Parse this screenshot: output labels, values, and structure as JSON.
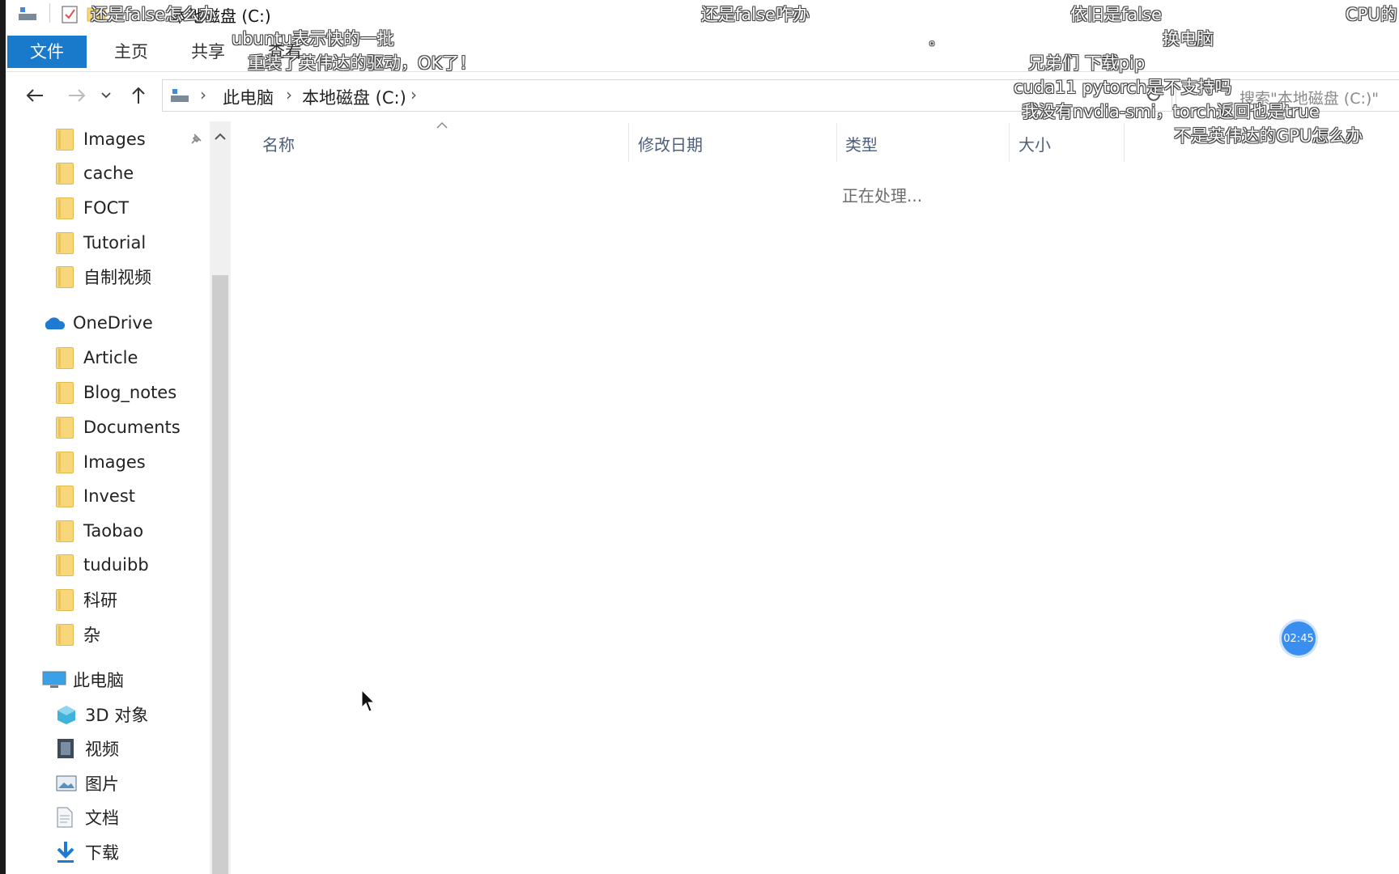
{
  "window": {
    "title": "本地磁盘 (C:)"
  },
  "ribbon": {
    "tabs": [
      "文件",
      "主页",
      "共享",
      "查看"
    ]
  },
  "address": {
    "crumbs": [
      "此电脑",
      "本地磁盘 (C:)"
    ],
    "search_placeholder": "搜索\"本地磁盘 (C:)\""
  },
  "sidebar": {
    "quick_access": [
      "Images",
      "cache",
      "FOCT",
      "Tutorial",
      "自制视频"
    ],
    "onedrive_label": "OneDrive",
    "onedrive_items": [
      "Article",
      "Blog_notes",
      "Documents",
      "Images",
      "Invest",
      "Taobao",
      "tuduibb",
      "科研",
      "杂"
    ],
    "this_pc_label": "此电脑",
    "this_pc_items": [
      "3D 对象",
      "视频",
      "图片",
      "文档",
      "下载"
    ]
  },
  "content": {
    "columns": [
      "名称",
      "修改日期",
      "类型",
      "大小"
    ],
    "status": "正在处理..."
  },
  "overlay": {
    "danmu": [
      "还是false怎么办",
      "还是false咋办",
      "依旧是false",
      "CPU的",
      "ubuntu表示快的一批",
      "换电脑",
      "重装了英伟达的驱动，OK了！",
      "兄弟们 下载pip",
      "cuda11 pytorch是不支持吗",
      "我没有nvdia-smi，torch返回也是true",
      "不是英伟达的GPU怎么办",
      "。"
    ],
    "timer": "02:45"
  },
  "colors": {
    "accent": "#1979ca",
    "folder": "#f7d77a"
  }
}
